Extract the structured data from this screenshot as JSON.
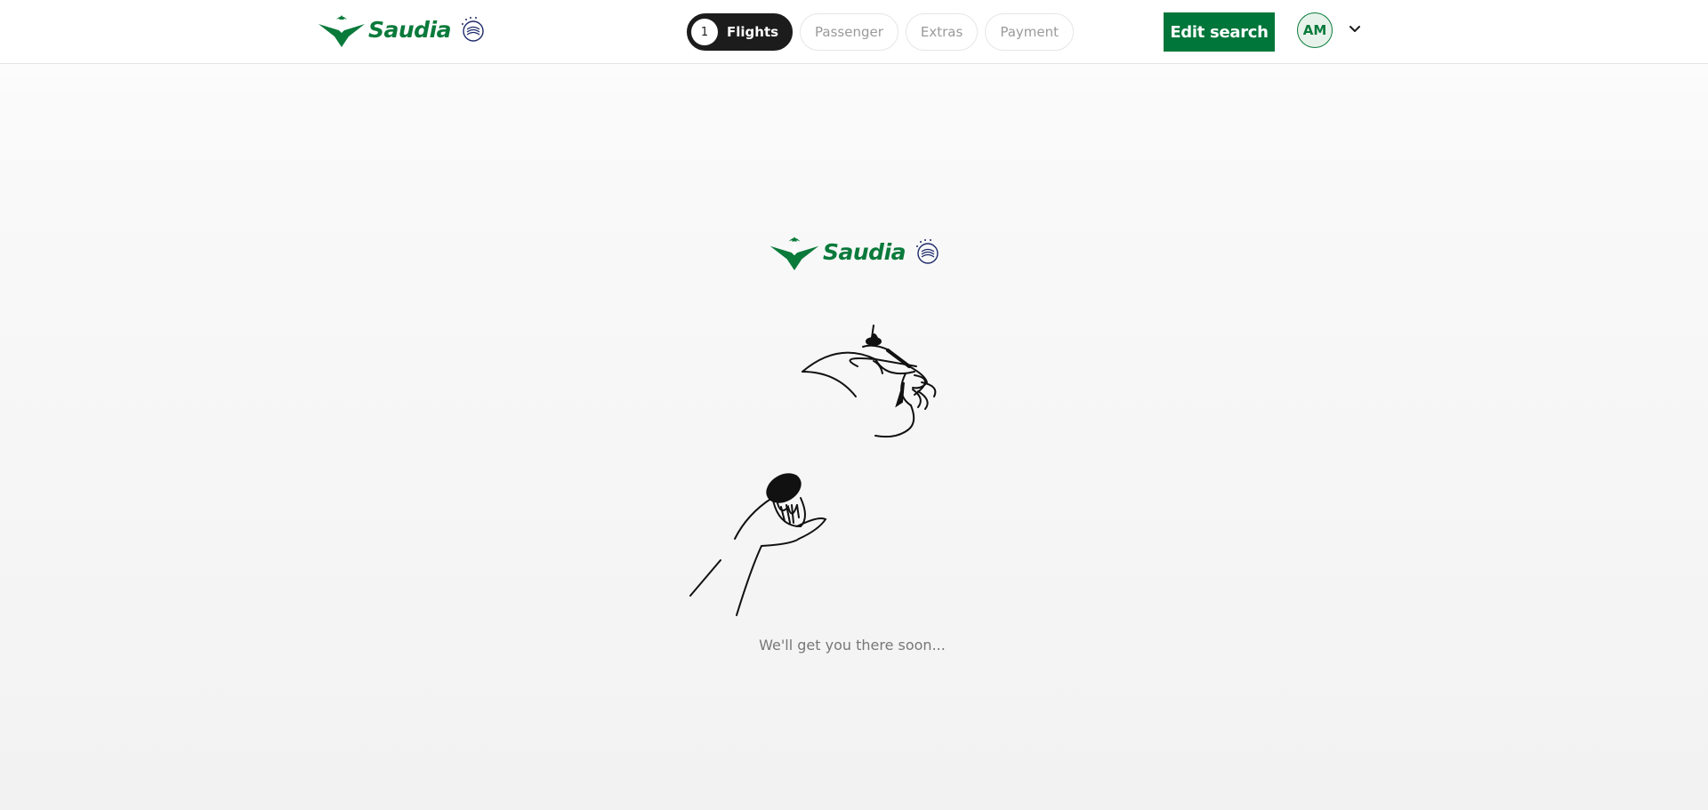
{
  "header": {
    "brand": "Saudia",
    "steps": [
      {
        "number": "1",
        "label": "Flights",
        "active": true
      },
      {
        "label": "Passenger"
      },
      {
        "label": "Extras"
      },
      {
        "label": "Payment"
      }
    ],
    "edit_search_label": "Edit search",
    "avatar_initials": "AM"
  },
  "loader": {
    "brand": "Saudia",
    "message": "We'll get you there soon..."
  },
  "colors": {
    "brand_green": "#00763a",
    "active_step": "#1c1c1c"
  },
  "icons": [
    "saudia-logo-icon",
    "skyteam-icon",
    "chevron-down-icon",
    "coffee-pouring-illustration"
  ]
}
